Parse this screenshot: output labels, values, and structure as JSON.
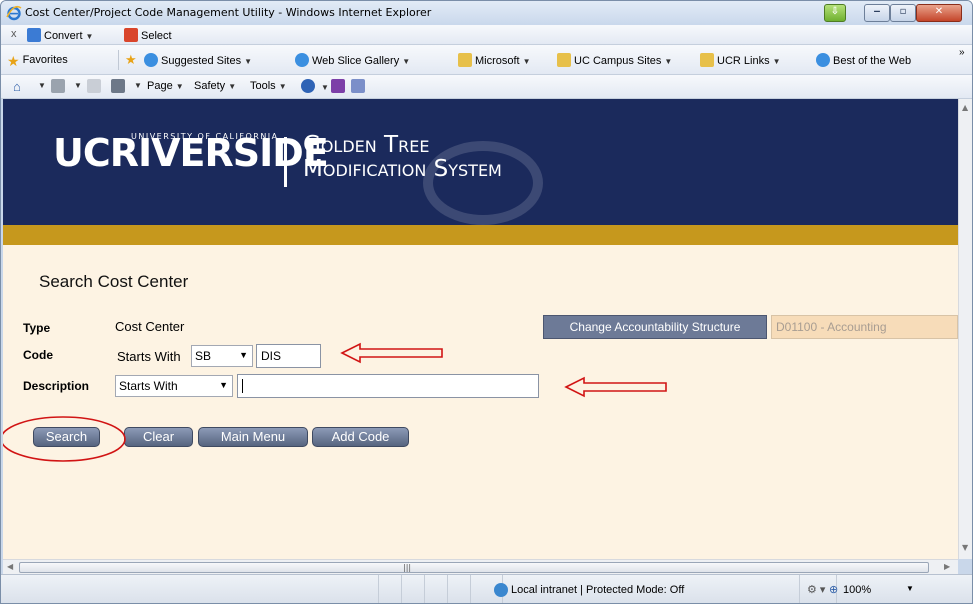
{
  "window": {
    "title": "Cost Center/Project Code Management Utility - Windows Internet Explorer"
  },
  "command_bar": {
    "convert_label": "Convert",
    "select_label": "Select",
    "close_glyph": "x"
  },
  "favorites_bar": {
    "favorites_label": "Favorites",
    "items": [
      {
        "label": "Suggested Sites",
        "icon": "ie-page-icon"
      },
      {
        "label": "Web Slice Gallery",
        "icon": "ie-page-icon"
      },
      {
        "label": "Microsoft",
        "icon": "folder-icon"
      },
      {
        "label": "UC Campus Sites",
        "icon": "folder-icon"
      },
      {
        "label": "UCR Links",
        "icon": "folder-icon"
      },
      {
        "label": "Best of the Web",
        "icon": "ie-page-icon"
      }
    ],
    "overflow": "»"
  },
  "tools_bar": {
    "page_label": "Page",
    "safety_label": "Safety",
    "tools_label": "Tools"
  },
  "banner": {
    "logo_main": "UCRIVERSIDE",
    "logo_sub": "UNIVERSITY OF CALIFORNIA",
    "system_title_line1": "Golden Tree",
    "system_title_line2": "Modification System"
  },
  "form": {
    "heading": "Search Cost Center",
    "type_label": "Type",
    "type_value": "Cost Center",
    "code_label": "Code",
    "code_match_text": "Starts With",
    "code_prefix_selected": "SB",
    "code_value": "DIS",
    "description_label": "Description",
    "description_match_selected": "Starts With",
    "description_value": "",
    "change_structure_label": "Change Accountability Structure",
    "structure_value": "D01100 - Accounting"
  },
  "buttons": {
    "search": "Search",
    "clear": "Clear",
    "main_menu": "Main Menu",
    "add_code": "Add Code"
  },
  "status_bar": {
    "zone": "Local intranet | Protected Mode: Off",
    "zoom": "100%"
  },
  "colors": {
    "banner_navy": "#1b2a5c",
    "gold_bar": "#c6981d",
    "page_background": "#fdf3e3",
    "annotation_red": "#d11414",
    "button_slate": "#6d7a97"
  }
}
